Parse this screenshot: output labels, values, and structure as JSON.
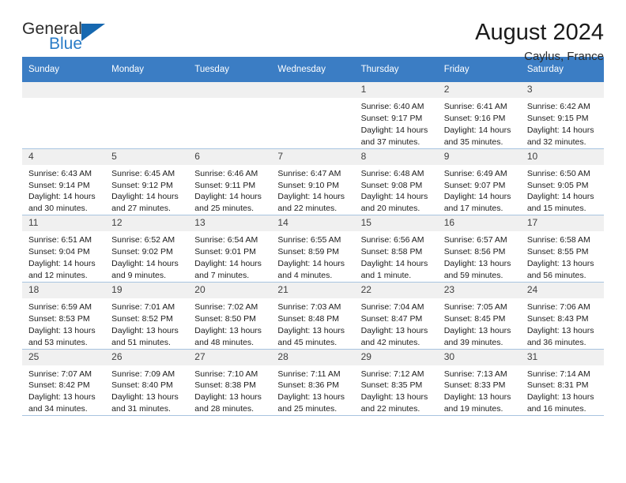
{
  "brand": {
    "name_part1": "General",
    "name_part2": "Blue",
    "accent_color": "#1668b0",
    "blue_text_color": "#2a7cc7"
  },
  "header": {
    "title": "August 2024",
    "location": "Caylus, France"
  },
  "theme": {
    "header_row_bg": "#3b7dc4",
    "daynum_bg": "#f0f0f0",
    "grid_line": "#a8c4e0"
  },
  "weekday_headers": [
    "Sunday",
    "Monday",
    "Tuesday",
    "Wednesday",
    "Thursday",
    "Friday",
    "Saturday"
  ],
  "weeks": [
    [
      {
        "day": "",
        "blank": true,
        "sunrise": "",
        "sunset": "",
        "daylight_line1": "",
        "daylight_line2": ""
      },
      {
        "day": "",
        "blank": true,
        "sunrise": "",
        "sunset": "",
        "daylight_line1": "",
        "daylight_line2": ""
      },
      {
        "day": "",
        "blank": true,
        "sunrise": "",
        "sunset": "",
        "daylight_line1": "",
        "daylight_line2": ""
      },
      {
        "day": "",
        "blank": true,
        "sunrise": "",
        "sunset": "",
        "daylight_line1": "",
        "daylight_line2": ""
      },
      {
        "day": "1",
        "blank": false,
        "sunrise": "Sunrise: 6:40 AM",
        "sunset": "Sunset: 9:17 PM",
        "daylight_line1": "Daylight: 14 hours",
        "daylight_line2": "and 37 minutes."
      },
      {
        "day": "2",
        "blank": false,
        "sunrise": "Sunrise: 6:41 AM",
        "sunset": "Sunset: 9:16 PM",
        "daylight_line1": "Daylight: 14 hours",
        "daylight_line2": "and 35 minutes."
      },
      {
        "day": "3",
        "blank": false,
        "sunrise": "Sunrise: 6:42 AM",
        "sunset": "Sunset: 9:15 PM",
        "daylight_line1": "Daylight: 14 hours",
        "daylight_line2": "and 32 minutes."
      }
    ],
    [
      {
        "day": "4",
        "blank": false,
        "sunrise": "Sunrise: 6:43 AM",
        "sunset": "Sunset: 9:14 PM",
        "daylight_line1": "Daylight: 14 hours",
        "daylight_line2": "and 30 minutes."
      },
      {
        "day": "5",
        "blank": false,
        "sunrise": "Sunrise: 6:45 AM",
        "sunset": "Sunset: 9:12 PM",
        "daylight_line1": "Daylight: 14 hours",
        "daylight_line2": "and 27 minutes."
      },
      {
        "day": "6",
        "blank": false,
        "sunrise": "Sunrise: 6:46 AM",
        "sunset": "Sunset: 9:11 PM",
        "daylight_line1": "Daylight: 14 hours",
        "daylight_line2": "and 25 minutes."
      },
      {
        "day": "7",
        "blank": false,
        "sunrise": "Sunrise: 6:47 AM",
        "sunset": "Sunset: 9:10 PM",
        "daylight_line1": "Daylight: 14 hours",
        "daylight_line2": "and 22 minutes."
      },
      {
        "day": "8",
        "blank": false,
        "sunrise": "Sunrise: 6:48 AM",
        "sunset": "Sunset: 9:08 PM",
        "daylight_line1": "Daylight: 14 hours",
        "daylight_line2": "and 20 minutes."
      },
      {
        "day": "9",
        "blank": false,
        "sunrise": "Sunrise: 6:49 AM",
        "sunset": "Sunset: 9:07 PM",
        "daylight_line1": "Daylight: 14 hours",
        "daylight_line2": "and 17 minutes."
      },
      {
        "day": "10",
        "blank": false,
        "sunrise": "Sunrise: 6:50 AM",
        "sunset": "Sunset: 9:05 PM",
        "daylight_line1": "Daylight: 14 hours",
        "daylight_line2": "and 15 minutes."
      }
    ],
    [
      {
        "day": "11",
        "blank": false,
        "sunrise": "Sunrise: 6:51 AM",
        "sunset": "Sunset: 9:04 PM",
        "daylight_line1": "Daylight: 14 hours",
        "daylight_line2": "and 12 minutes."
      },
      {
        "day": "12",
        "blank": false,
        "sunrise": "Sunrise: 6:52 AM",
        "sunset": "Sunset: 9:02 PM",
        "daylight_line1": "Daylight: 14 hours",
        "daylight_line2": "and 9 minutes."
      },
      {
        "day": "13",
        "blank": false,
        "sunrise": "Sunrise: 6:54 AM",
        "sunset": "Sunset: 9:01 PM",
        "daylight_line1": "Daylight: 14 hours",
        "daylight_line2": "and 7 minutes."
      },
      {
        "day": "14",
        "blank": false,
        "sunrise": "Sunrise: 6:55 AM",
        "sunset": "Sunset: 8:59 PM",
        "daylight_line1": "Daylight: 14 hours",
        "daylight_line2": "and 4 minutes."
      },
      {
        "day": "15",
        "blank": false,
        "sunrise": "Sunrise: 6:56 AM",
        "sunset": "Sunset: 8:58 PM",
        "daylight_line1": "Daylight: 14 hours",
        "daylight_line2": "and 1 minute."
      },
      {
        "day": "16",
        "blank": false,
        "sunrise": "Sunrise: 6:57 AM",
        "sunset": "Sunset: 8:56 PM",
        "daylight_line1": "Daylight: 13 hours",
        "daylight_line2": "and 59 minutes."
      },
      {
        "day": "17",
        "blank": false,
        "sunrise": "Sunrise: 6:58 AM",
        "sunset": "Sunset: 8:55 PM",
        "daylight_line1": "Daylight: 13 hours",
        "daylight_line2": "and 56 minutes."
      }
    ],
    [
      {
        "day": "18",
        "blank": false,
        "sunrise": "Sunrise: 6:59 AM",
        "sunset": "Sunset: 8:53 PM",
        "daylight_line1": "Daylight: 13 hours",
        "daylight_line2": "and 53 minutes."
      },
      {
        "day": "19",
        "blank": false,
        "sunrise": "Sunrise: 7:01 AM",
        "sunset": "Sunset: 8:52 PM",
        "daylight_line1": "Daylight: 13 hours",
        "daylight_line2": "and 51 minutes."
      },
      {
        "day": "20",
        "blank": false,
        "sunrise": "Sunrise: 7:02 AM",
        "sunset": "Sunset: 8:50 PM",
        "daylight_line1": "Daylight: 13 hours",
        "daylight_line2": "and 48 minutes."
      },
      {
        "day": "21",
        "blank": false,
        "sunrise": "Sunrise: 7:03 AM",
        "sunset": "Sunset: 8:48 PM",
        "daylight_line1": "Daylight: 13 hours",
        "daylight_line2": "and 45 minutes."
      },
      {
        "day": "22",
        "blank": false,
        "sunrise": "Sunrise: 7:04 AM",
        "sunset": "Sunset: 8:47 PM",
        "daylight_line1": "Daylight: 13 hours",
        "daylight_line2": "and 42 minutes."
      },
      {
        "day": "23",
        "blank": false,
        "sunrise": "Sunrise: 7:05 AM",
        "sunset": "Sunset: 8:45 PM",
        "daylight_line1": "Daylight: 13 hours",
        "daylight_line2": "and 39 minutes."
      },
      {
        "day": "24",
        "blank": false,
        "sunrise": "Sunrise: 7:06 AM",
        "sunset": "Sunset: 8:43 PM",
        "daylight_line1": "Daylight: 13 hours",
        "daylight_line2": "and 36 minutes."
      }
    ],
    [
      {
        "day": "25",
        "blank": false,
        "sunrise": "Sunrise: 7:07 AM",
        "sunset": "Sunset: 8:42 PM",
        "daylight_line1": "Daylight: 13 hours",
        "daylight_line2": "and 34 minutes."
      },
      {
        "day": "26",
        "blank": false,
        "sunrise": "Sunrise: 7:09 AM",
        "sunset": "Sunset: 8:40 PM",
        "daylight_line1": "Daylight: 13 hours",
        "daylight_line2": "and 31 minutes."
      },
      {
        "day": "27",
        "blank": false,
        "sunrise": "Sunrise: 7:10 AM",
        "sunset": "Sunset: 8:38 PM",
        "daylight_line1": "Daylight: 13 hours",
        "daylight_line2": "and 28 minutes."
      },
      {
        "day": "28",
        "blank": false,
        "sunrise": "Sunrise: 7:11 AM",
        "sunset": "Sunset: 8:36 PM",
        "daylight_line1": "Daylight: 13 hours",
        "daylight_line2": "and 25 minutes."
      },
      {
        "day": "29",
        "blank": false,
        "sunrise": "Sunrise: 7:12 AM",
        "sunset": "Sunset: 8:35 PM",
        "daylight_line1": "Daylight: 13 hours",
        "daylight_line2": "and 22 minutes."
      },
      {
        "day": "30",
        "blank": false,
        "sunrise": "Sunrise: 7:13 AM",
        "sunset": "Sunset: 8:33 PM",
        "daylight_line1": "Daylight: 13 hours",
        "daylight_line2": "and 19 minutes."
      },
      {
        "day": "31",
        "blank": false,
        "sunrise": "Sunrise: 7:14 AM",
        "sunset": "Sunset: 8:31 PM",
        "daylight_line1": "Daylight: 13 hours",
        "daylight_line2": "and 16 minutes."
      }
    ]
  ]
}
